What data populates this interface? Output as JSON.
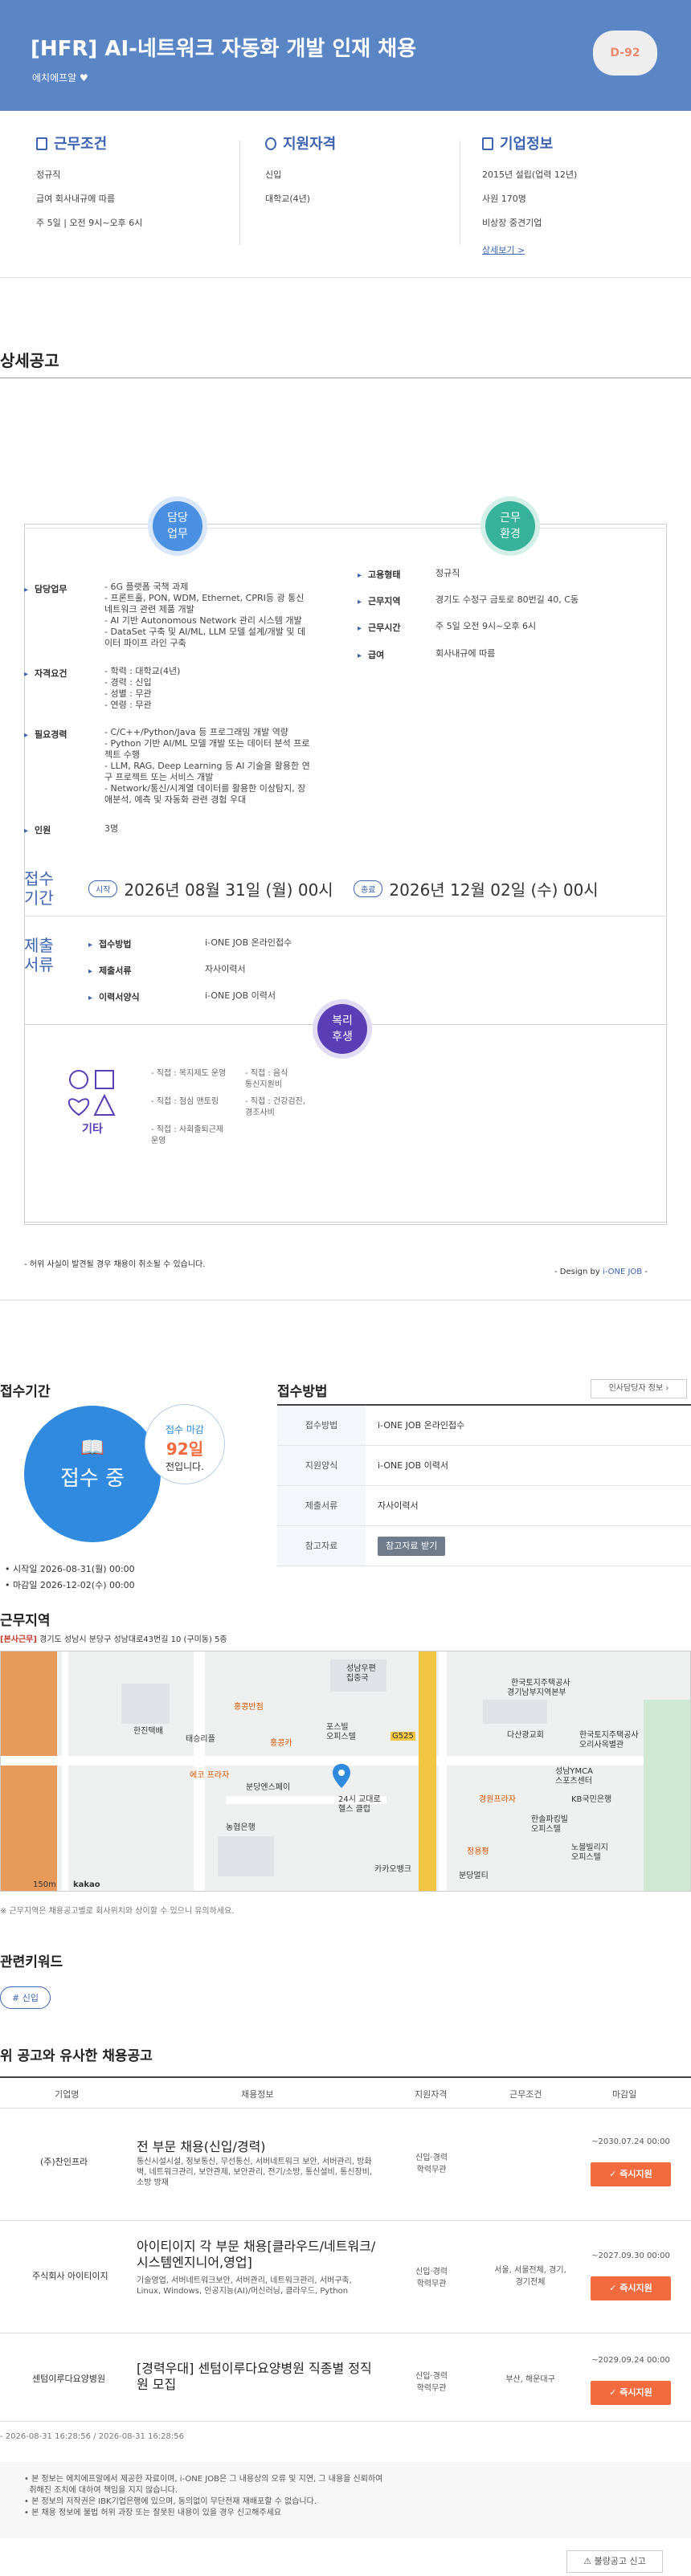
{
  "header": {
    "title": "[HFR] AI-네트워크 자동화 개발 인재 채용",
    "company": "에치에프알",
    "dday": "D-92"
  },
  "summary": {
    "conditions": {
      "heading": "근무조건",
      "lines": [
        "정규직",
        "급여 회사내규에 따름",
        "주 5일 | 오전 9시~오후 6시"
      ]
    },
    "qualifications": {
      "heading": "지원자격",
      "lines": [
        "신입",
        "대학교(4년)"
      ]
    },
    "company": {
      "heading": "기업정보",
      "lines": [
        "2015년 설립(업력 12년)",
        "사원 170명",
        "비상장 중견기업"
      ],
      "link": "상세보기 >"
    }
  },
  "detail": {
    "section_title": "상세공고",
    "duty_circle": [
      "담당",
      "업무"
    ],
    "env_circle": [
      "근무",
      "환경"
    ],
    "left_rows": [
      {
        "label": "담당업무",
        "lines": [
          "- 6G 플랫폼 국책 과제",
          "- 프론트홀, PON, WDM, Ethernet, CPRI등 광 통신",
          "  네트워크 관련 제품 개발",
          "- AI 기반 Autonomous Network 관리 시스템 개발",
          "- DataSet 구축 및 AI/ML, LLM 모델 설계/개발 및 데",
          "  이터 파이프 라인 구축"
        ]
      },
      {
        "label": "자격요건",
        "lines": [
          "- 학력 : 대학교(4년)",
          "- 경력 : 신입",
          "- 성별 : 무관",
          "- 연령 : 무관"
        ]
      },
      {
        "label": "필요경력",
        "lines": [
          "- C/C++/Python/Java 등 프로그래밍 개발 역량",
          "- Python 기반 AI/ML 모델 개발 또는 데이터 분석 프로",
          "  젝트 수행",
          "- LLM, RAG, Deep Learning 등 AI 기술을 활용한 연",
          "  구 프로젝트 또는 서비스 개발",
          "- Network/통신/시계열 데이터를 활용한 이상탐지, 장",
          "  애분석, 예측 및 자동화 관련 경험 우대"
        ]
      },
      {
        "label": "인원",
        "lines": [
          "3명"
        ]
      }
    ],
    "right_rows": [
      {
        "label": "고용형태",
        "value": "정규직"
      },
      {
        "label": "근무지역",
        "value": "경기도 수정구 금토로 80번길 40, C동"
      },
      {
        "label": "근무시간",
        "value": "주 5일 오전 9시~오후 6시"
      },
      {
        "label": "급여",
        "value": "회사내규에 따름"
      }
    ],
    "receipt": {
      "heading": [
        "접수",
        "기간"
      ],
      "start_pill": "시작",
      "start": "2026년 08월 31일 (월) 00시",
      "end_pill": "종료",
      "end": "2026년 12월 02일 (수) 00시"
    },
    "documents": {
      "heading": [
        "제출",
        "서류"
      ],
      "rows": [
        {
          "label": "접수방법",
          "value": "i-ONE JOB 온라인접수"
        },
        {
          "label": "제출서류",
          "value": "자사이력서"
        },
        {
          "label": "이력서양식",
          "value": "i-ONE JOB 이력서"
        }
      ]
    },
    "benefits": {
      "circle": [
        "복리",
        "후생"
      ],
      "category": "기타",
      "items": [
        "- 직접 : 복지제도 운영",
        "- 직접 : 음식",
        "통신지원비",
        "- 직접 : 점심 맨토링",
        "- 직접 : 건강검진,",
        "경조사비",
        "- 직접 : 사회출퇴근제",
        "운영"
      ]
    },
    "notice": "- 허위 사실이 발견될 경우 채용이 취소될 수 있습니다.",
    "design_by_prefix": "- Design by ",
    "design_by_brand": "i-ONE JOB",
    "design_by_suffix": " -"
  },
  "apply": {
    "section_title": "접수기간",
    "status": "접수 중",
    "deadline_label": "접수 마감",
    "days_left": "92일",
    "days_suffix": "전입니다.",
    "start_line": "시작일 2026-08-31(월) 00:00",
    "end_line": "마감일 2026-12-02(수) 00:00",
    "method_title": "접수방법",
    "hr_button": "인사담당자 정보",
    "rows": [
      {
        "th": "접수방법",
        "td": "i-ONE JOB 온라인접수"
      },
      {
        "th": "지원양식",
        "td": "i-ONE JOB 이력서"
      },
      {
        "th": "제출서류",
        "td": "자사이력서"
      },
      {
        "th": "참고자료",
        "td": "참고자료 받기"
      }
    ]
  },
  "location": {
    "section_title": "근무지역",
    "tag": "[본사근무]",
    "address": "경기도 성남시 분당구 성남대로43번길 10 (구미동) 5층",
    "map_labels": [
      "한진택배",
      "태승리플",
      "홍콩반점",
      "홍콩카",
      "성남우편",
      "집중국",
      "포스빌",
      "오피스텔",
      "한국토지주택공사",
      "경기남부지역본부",
      "다산광교회",
      "한국토지주택공사",
      "오리사옥별관",
      "성남YMCA",
      "스포츠센터",
      "KB국민은행",
      "경원프라자",
      "에코 프라자",
      "분당엔스페이",
      "농협은행",
      "24시 교대로",
      "헬스 클럽",
      "한솔파킹빌",
      "오피스텔",
      "노블빌리지",
      "오피스텔",
      "분당멀티",
      "정용평",
      "카카오뱅크",
      "G525",
      "150m",
      "kakao"
    ],
    "map_note": "※ 근무지역은 채용공고별로 회사위치와 상이할 수 있으니 유의하세요."
  },
  "keywords": {
    "section_title": "관련키워드",
    "tags": [
      "# 신입"
    ]
  },
  "similar": {
    "section_title": "위 공고와 유사한 채용공고",
    "headers": [
      "기업명",
      "채용정보",
      "지원자격",
      "근무조건",
      "마감일"
    ],
    "rows": [
      {
        "company": "(주)찬인프라",
        "title": "전 부문 채용(신입/경력)",
        "tags": "통신시설시설, 정보통신, 무선통신, 서버네트워크 보안, 서버관리, 방화벽, 네트워크관리, 보안관제, 보안관리, 전기/소방, 통신설비, 통신장비, 소방 방재",
        "qual": "신입·경력 학력무관",
        "cond": "",
        "deadline": "~2030.07.24 00:00",
        "button": "즉시지원"
      },
      {
        "company": "주식회사 아이티이지",
        "title": "아이티이지 각 부문 채용[클라우드/네트워크/시스템엔지니어,영업]",
        "tags": "기술영업, 서버네트워크보안, 서버관리, 네트워크관리, 서버구축, Linux, Windows, 인공지능(AI)/머신러닝, 클라우드, Python",
        "qual": "신입·경력 학력무관",
        "cond": "서울, 서울전체, 경기, 경기전체",
        "deadline": "~2027.09.30 00:00",
        "button": "즉시지원"
      },
      {
        "company": "센텀이루다요양병원",
        "title": "[경력우대] 센텀이루다요양병원 직종별 정직원 모집",
        "tags": "",
        "qual": "신입·경력 학력무관",
        "cond": "부산, 해운대구",
        "deadline": "~2029.09.24 00:00",
        "button": "즉시지원"
      }
    ]
  },
  "footer": {
    "dates": "- 2026-08-31 16:28:56 / 2026-08-31 16:28:56",
    "notes": [
      "본 정보는 에치에프알에서 제공한 자료이며, i-ONE JOB은 그 내용상의 오류 및 지연, 그 내용을 신뢰하여",
      "취해진 조치에 대하여 책임을 지지 않습니다.",
      "본 정보의 저작권은 IBK기업은행에 있으며, 동의없이 무단전재 재배포할 수 없습니다.",
      "본 채용 정보에 불법 허위 과장 또는 잘못된 내용이 있을 경우 신고해주세요"
    ],
    "report_button": "불량공고 신고"
  }
}
